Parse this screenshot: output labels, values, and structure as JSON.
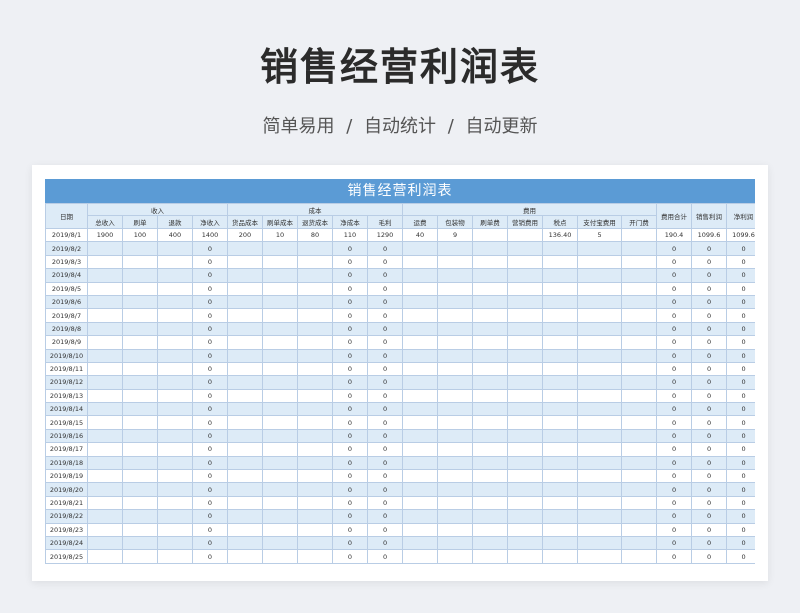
{
  "page": {
    "title": "销售经营利润表",
    "subtitle": "简单易用 / 自动统计 / 自动更新"
  },
  "sheet": {
    "title": "销售经营利润表",
    "groups": {
      "date": "日期",
      "income": "收入",
      "cost": "成本",
      "gross": "毛利",
      "expense": "费用",
      "total": "费用合计",
      "sales_profit": "销售利润",
      "net_profit": "净利润"
    },
    "income_cols": [
      "总收入",
      "刷单",
      "退款",
      "净收入"
    ],
    "cost_cols": [
      "货品成本",
      "刷单成本",
      "退货成本",
      "净成本"
    ],
    "expense_cols": [
      "运费",
      "包装物",
      "刷单费",
      "营销费用",
      "税点",
      "支付宝费用",
      "开门费"
    ],
    "rows": [
      [
        "2019/8/1",
        "1900",
        "100",
        "400",
        "1400",
        "200",
        "10",
        "80",
        "110",
        "1290",
        "40",
        "9",
        "",
        "",
        "136.40",
        "5",
        "",
        "190.4",
        "1099.6",
        "1099.6"
      ],
      [
        "2019/8/2",
        "",
        "",
        "",
        "0",
        "",
        "",
        "",
        "0",
        "0",
        "",
        "",
        "",
        "",
        "",
        "",
        "",
        "0",
        "0",
        "0"
      ],
      [
        "2019/8/3",
        "",
        "",
        "",
        "0",
        "",
        "",
        "",
        "0",
        "0",
        "",
        "",
        "",
        "",
        "",
        "",
        "",
        "0",
        "0",
        "0"
      ],
      [
        "2019/8/4",
        "",
        "",
        "",
        "0",
        "",
        "",
        "",
        "0",
        "0",
        "",
        "",
        "",
        "",
        "",
        "",
        "",
        "0",
        "0",
        "0"
      ],
      [
        "2019/8/5",
        "",
        "",
        "",
        "0",
        "",
        "",
        "",
        "0",
        "0",
        "",
        "",
        "",
        "",
        "",
        "",
        "",
        "0",
        "0",
        "0"
      ],
      [
        "2019/8/6",
        "",
        "",
        "",
        "0",
        "",
        "",
        "",
        "0",
        "0",
        "",
        "",
        "",
        "",
        "",
        "",
        "",
        "0",
        "0",
        "0"
      ],
      [
        "2019/8/7",
        "",
        "",
        "",
        "0",
        "",
        "",
        "",
        "0",
        "0",
        "",
        "",
        "",
        "",
        "",
        "",
        "",
        "0",
        "0",
        "0"
      ],
      [
        "2019/8/8",
        "",
        "",
        "",
        "0",
        "",
        "",
        "",
        "0",
        "0",
        "",
        "",
        "",
        "",
        "",
        "",
        "",
        "0",
        "0",
        "0"
      ],
      [
        "2019/8/9",
        "",
        "",
        "",
        "0",
        "",
        "",
        "",
        "0",
        "0",
        "",
        "",
        "",
        "",
        "",
        "",
        "",
        "0",
        "0",
        "0"
      ],
      [
        "2019/8/10",
        "",
        "",
        "",
        "0",
        "",
        "",
        "",
        "0",
        "0",
        "",
        "",
        "",
        "",
        "",
        "",
        "",
        "0",
        "0",
        "0"
      ],
      [
        "2019/8/11",
        "",
        "",
        "",
        "0",
        "",
        "",
        "",
        "0",
        "0",
        "",
        "",
        "",
        "",
        "",
        "",
        "",
        "0",
        "0",
        "0"
      ],
      [
        "2019/8/12",
        "",
        "",
        "",
        "0",
        "",
        "",
        "",
        "0",
        "0",
        "",
        "",
        "",
        "",
        "",
        "",
        "",
        "0",
        "0",
        "0"
      ],
      [
        "2019/8/13",
        "",
        "",
        "",
        "0",
        "",
        "",
        "",
        "0",
        "0",
        "",
        "",
        "",
        "",
        "",
        "",
        "",
        "0",
        "0",
        "0"
      ],
      [
        "2019/8/14",
        "",
        "",
        "",
        "0",
        "",
        "",
        "",
        "0",
        "0",
        "",
        "",
        "",
        "",
        "",
        "",
        "",
        "0",
        "0",
        "0"
      ],
      [
        "2019/8/15",
        "",
        "",
        "",
        "0",
        "",
        "",
        "",
        "0",
        "0",
        "",
        "",
        "",
        "",
        "",
        "",
        "",
        "0",
        "0",
        "0"
      ],
      [
        "2019/8/16",
        "",
        "",
        "",
        "0",
        "",
        "",
        "",
        "0",
        "0",
        "",
        "",
        "",
        "",
        "",
        "",
        "",
        "0",
        "0",
        "0"
      ],
      [
        "2019/8/17",
        "",
        "",
        "",
        "0",
        "",
        "",
        "",
        "0",
        "0",
        "",
        "",
        "",
        "",
        "",
        "",
        "",
        "0",
        "0",
        "0"
      ],
      [
        "2019/8/18",
        "",
        "",
        "",
        "0",
        "",
        "",
        "",
        "0",
        "0",
        "",
        "",
        "",
        "",
        "",
        "",
        "",
        "0",
        "0",
        "0"
      ],
      [
        "2019/8/19",
        "",
        "",
        "",
        "0",
        "",
        "",
        "",
        "0",
        "0",
        "",
        "",
        "",
        "",
        "",
        "",
        "",
        "0",
        "0",
        "0"
      ],
      [
        "2019/8/20",
        "",
        "",
        "",
        "0",
        "",
        "",
        "",
        "0",
        "0",
        "",
        "",
        "",
        "",
        "",
        "",
        "",
        "0",
        "0",
        "0"
      ],
      [
        "2019/8/21",
        "",
        "",
        "",
        "0",
        "",
        "",
        "",
        "0",
        "0",
        "",
        "",
        "",
        "",
        "",
        "",
        "",
        "0",
        "0",
        "0"
      ],
      [
        "2019/8/22",
        "",
        "",
        "",
        "0",
        "",
        "",
        "",
        "0",
        "0",
        "",
        "",
        "",
        "",
        "",
        "",
        "",
        "0",
        "0",
        "0"
      ],
      [
        "2019/8/23",
        "",
        "",
        "",
        "0",
        "",
        "",
        "",
        "0",
        "0",
        "",
        "",
        "",
        "",
        "",
        "",
        "",
        "0",
        "0",
        "0"
      ],
      [
        "2019/8/24",
        "",
        "",
        "",
        "0",
        "",
        "",
        "",
        "0",
        "0",
        "",
        "",
        "",
        "",
        "",
        "",
        "",
        "0",
        "0",
        "0"
      ],
      [
        "2019/8/25",
        "",
        "",
        "",
        "0",
        "",
        "",
        "",
        "0",
        "0",
        "",
        "",
        "",
        "",
        "",
        "",
        "",
        "0",
        "0",
        "0"
      ]
    ]
  },
  "colors": {
    "header_bar": "#5b9bd5",
    "header_cell": "#ddebf7",
    "border": "#b9cde5"
  }
}
